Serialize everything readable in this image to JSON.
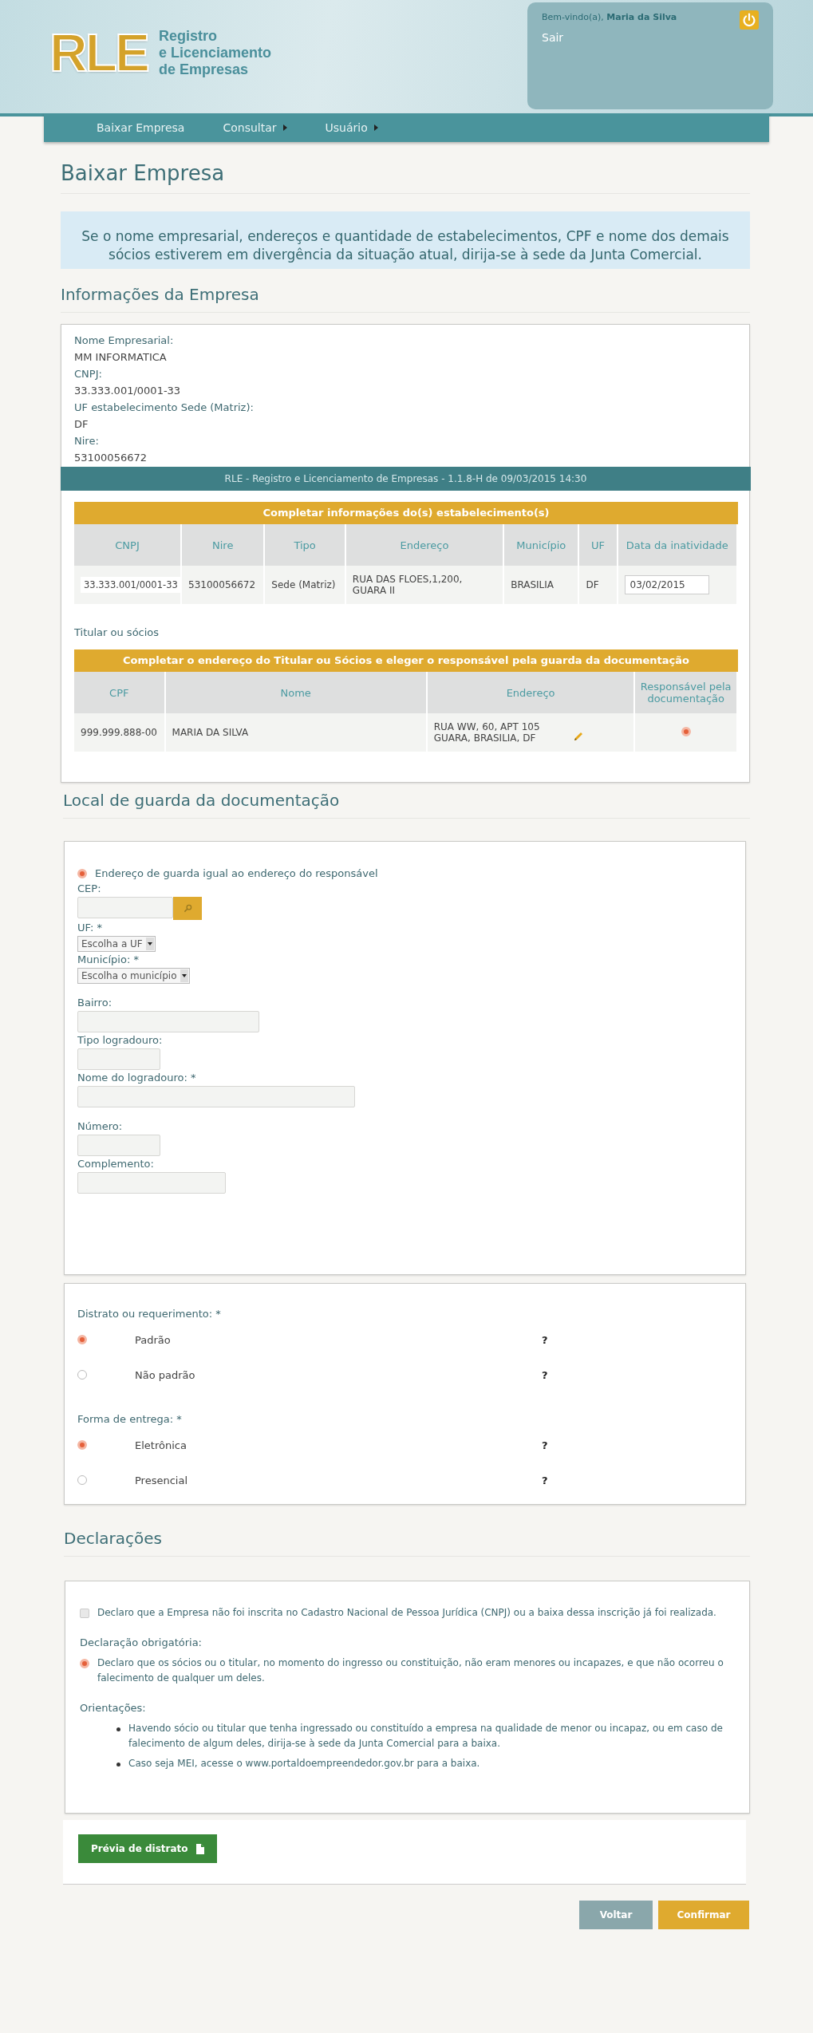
{
  "header": {
    "logo_mark": "RLE",
    "logo_lines": [
      "Registro",
      "e Licenciamento",
      "de Empresas"
    ]
  },
  "user_panel": {
    "greeting": "Bem-vindo(a),",
    "user_name": "Maria da Silva",
    "logout_link": "Sair"
  },
  "nav": [
    {
      "label": "Baixar Empresa",
      "has_submenu": false
    },
    {
      "label": "Consultar",
      "has_submenu": true
    },
    {
      "label": "Usuário",
      "has_submenu": true
    }
  ],
  "page_title": "Baixar Empresa",
  "notice": "Se o nome empresarial, endereços e quantidade de estabelecimentos, CPF e nome dos demais sócios estiverem em divergência da situação atual, dirija-se à sede da Junta Comercial.",
  "company_info": {
    "title": "Informações da Empresa",
    "fields": [
      {
        "label": "Nome Empresarial:",
        "value": "MM INFORMATICA"
      },
      {
        "label": "CNPJ:",
        "value": "33.333.001/0001-33"
      },
      {
        "label": "UF estabelecimento Sede (Matriz):",
        "value": "DF"
      },
      {
        "label": "Nire:",
        "value": "53100056672"
      }
    ]
  },
  "footer_bar": "RLE - Registro e Licenciamento de Empresas - 1.1.8-H de 09/03/2015 14:30",
  "establishments": {
    "banner": "Completar informações do(s) estabelecimento(s)",
    "columns": [
      "CNPJ",
      "Nire",
      "Tipo",
      "Endereço",
      "Município",
      "UF",
      "Data da inatividade"
    ],
    "rows": [
      {
        "cnpj": "33.333.001/0001-33",
        "nire": "53100056672",
        "tipo": "Sede (Matriz)",
        "endereco": "RUA DAS FLOES,1,200, GUARA II",
        "municipio": "BRASILIA",
        "uf": "DF",
        "data_inatividade": "03/02/2015"
      }
    ]
  },
  "partners": {
    "title": "Titular ou sócios",
    "banner": "Completar o endereço do Titular ou Sócios e eleger o responsável pela guarda da documentação",
    "columns": [
      "CPF",
      "Nome",
      "Endereço",
      "Responsável pela documentação"
    ],
    "rows": [
      {
        "cpf": "999.999.888-00",
        "nome": "MARIA DA SILVA",
        "endereco": "RUA WW, 60, APT 105 GUARA, BRASILIA, DF",
        "selected": true
      }
    ]
  },
  "storage": {
    "title": "Local de guarda da documentação",
    "same_address": {
      "label": "Endereço de guarda igual ao endereço do responsável",
      "selected": true
    },
    "fields": [
      {
        "kind": "cep",
        "label": "CEP:"
      },
      {
        "kind": "select",
        "label": "UF: *",
        "placeholder": "Escolha a UF"
      },
      {
        "kind": "select",
        "label": "Município: *",
        "placeholder": "Escolha o município"
      },
      {
        "kind": "text",
        "label": "Bairro:"
      },
      {
        "kind": "text",
        "label": "Tipo logradouro:"
      },
      {
        "kind": "text",
        "label": "Nome do logradouro: *"
      },
      {
        "kind": "text",
        "label": "Número:"
      },
      {
        "kind": "text",
        "label": "Complemento:"
      }
    ]
  },
  "options": [
    {
      "label": "Distrato ou requerimento: *",
      "choices": [
        {
          "label": "Padrão",
          "selected": true,
          "help": "?"
        },
        {
          "label": "Não padrão",
          "selected": false,
          "help": "?"
        }
      ]
    },
    {
      "label": "Forma de entrega: *",
      "choices": [
        {
          "label": "Eletrônica",
          "selected": true,
          "help": "?"
        },
        {
          "label": "Presencial",
          "selected": false,
          "help": "?"
        }
      ]
    }
  ],
  "declarations": {
    "title": "Declarações",
    "checkbox": {
      "label": "Declaro que a Empresa não foi inscrita no Cadastro Nacional de Pessoa Jurídica (CNPJ) ou a baixa dessa inscrição já foi realizada.",
      "checked": false
    },
    "mandatory_label": "Declaração obrigatória:",
    "mandatory": {
      "label": "Declaro que os sócios ou o titular, no momento do ingresso ou constituição, não eram menores ou incapazes, e que não ocorreu o falecimento de qualquer um deles.",
      "selected": true
    },
    "guidance_label": "Orientações:",
    "guidance": [
      "Havendo sócio ou titular que tenha ingressado ou constituído a empresa na qualidade de menor ou incapaz, ou em caso de falecimento de algum deles, dirija-se à sede da Junta Comercial para a baixa.",
      "Caso seja MEI, acesse o www.portaldoempreendedor.gov.br para a baixa."
    ]
  },
  "preview_button": "Prévia de distrato",
  "actions": [
    {
      "label": "Voltar",
      "kind": "secondary"
    },
    {
      "label": "Confirmar",
      "kind": "primary"
    }
  ]
}
